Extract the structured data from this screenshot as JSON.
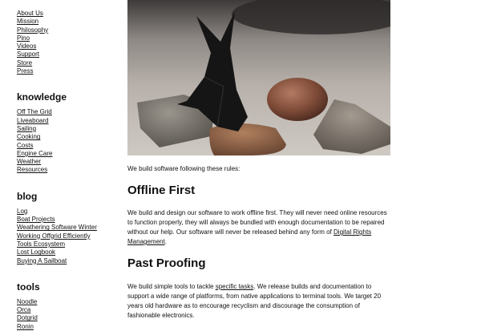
{
  "sidebar": {
    "top_links": [
      "About Us",
      "Mission",
      "Philosophy",
      "Pino",
      "Videos",
      "Support",
      "Store",
      "Press"
    ],
    "sections": [
      {
        "heading": "knowledge",
        "links": [
          "Off The Grid",
          "Liveaboard",
          "Sailing",
          "Cooking",
          "Costs",
          "Engine Care",
          "Weather",
          "Resources"
        ]
      },
      {
        "heading": "blog",
        "links": [
          "Log",
          "Boat Projects",
          "Weathering Software Winter",
          "Working Offgrid Efficiently",
          "Tools Ecosystem",
          "Lost Logbook",
          "Buying A Sailboat"
        ]
      },
      {
        "heading": "tools",
        "links": [
          "Noodle",
          "Orca",
          "Dotgrid",
          "Ronin"
        ]
      }
    ]
  },
  "main": {
    "intro": "We build software following these rules:",
    "offline": {
      "title": "Offline First",
      "text_1": "We build and design our software to work offline first. They will never need online resources to function properly, they will always be bundled with enough documentation to be repaired without our help. Our software will never be released behind any form of ",
      "link": "Digital Rights Management",
      "text_2": "."
    },
    "past": {
      "title": "Past Proofing",
      "text_1": "We build simple tools to tackle ",
      "link": "specific tasks",
      "text_2": ". We release builds and documentation to support a wide range of platforms, from native applications to terminal tools. We target 20 years old hardware as to encourage recyclism and discourage the consumption of fashionable electronics."
    }
  }
}
